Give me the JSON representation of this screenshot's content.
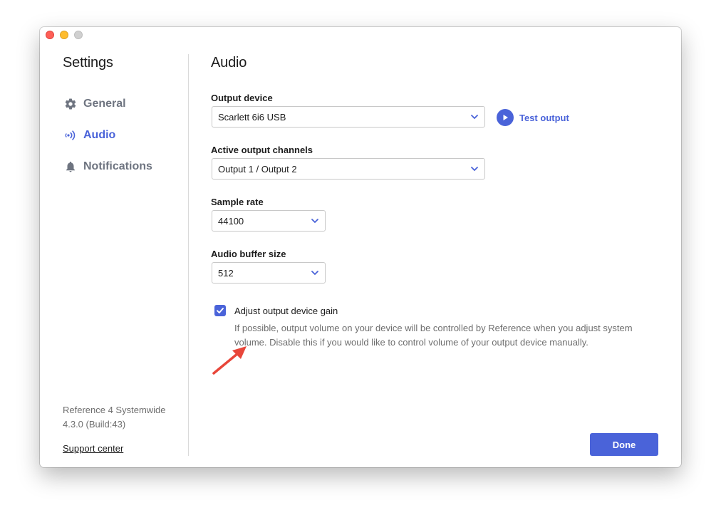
{
  "sidebar": {
    "title": "Settings",
    "items": [
      {
        "label": "General",
        "icon": "gear-icon",
        "active": false
      },
      {
        "label": "Audio",
        "icon": "audio-waves-icon",
        "active": true
      },
      {
        "label": "Notifications",
        "icon": "bell-icon",
        "active": false
      }
    ],
    "version_line1": "Reference 4 Systemwide",
    "version_line2": "4.3.0 (Build:43)",
    "support_link": "Support center"
  },
  "main": {
    "title": "Audio",
    "output_device": {
      "label": "Output device",
      "value": "Scarlett 6i6 USB"
    },
    "test_output": {
      "label": "Test output",
      "icon": "play-icon"
    },
    "channels": {
      "label": "Active output channels",
      "value": "Output 1 / Output 2"
    },
    "sample_rate": {
      "label": "Sample rate",
      "value": "44100"
    },
    "buffer_size": {
      "label": "Audio buffer size",
      "value": "512"
    },
    "gain": {
      "label": "Adjust output device gain",
      "checked": true,
      "description": "If possible, output volume on your device will be controlled by Reference when you adjust system volume. Disable this if you would like to control volume of your output device manually."
    },
    "done_label": "Done"
  },
  "colors": {
    "accent": "#4a63d9",
    "annotation_arrow": "#e8463a"
  }
}
